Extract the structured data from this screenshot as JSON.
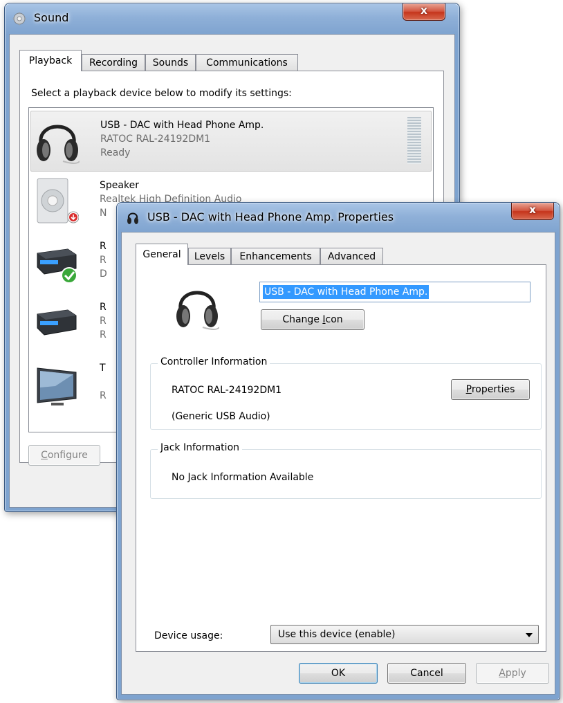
{
  "sound_window": {
    "title": "Sound",
    "close_label": "x",
    "tabs": [
      {
        "label": "Playback"
      },
      {
        "label": "Recording"
      },
      {
        "label": "Sounds"
      },
      {
        "label": "Communications"
      }
    ],
    "instruction": "Select a playback device below to modify its settings:",
    "devices": [
      {
        "name": "USB - DAC with Head Phone Amp.",
        "driver": "RATOC RAL-24192DM1",
        "status": "Ready",
        "icon": "headphones-icon",
        "selected": true
      },
      {
        "name": "Speaker",
        "driver": "Realtek High Definition Audio",
        "status": "N",
        "icon": "speaker-icon",
        "badge": "disabled-badge"
      },
      {
        "name": "R",
        "driver": "R",
        "status": "D",
        "icon": "receiver-icon",
        "badge": "default-check-badge"
      },
      {
        "name": "R",
        "driver": "R",
        "status": "R",
        "icon": "receiver-icon"
      },
      {
        "name": "T",
        "driver": "",
        "status": "R",
        "icon": "monitor-icon"
      }
    ],
    "configure_button": {
      "pre": "",
      "underline": "C",
      "post": "onfigure"
    }
  },
  "properties_dialog": {
    "title": "USB - DAC with Head Phone Amp. Properties",
    "close_label": "x",
    "tabs": [
      {
        "label": "General"
      },
      {
        "label": "Levels"
      },
      {
        "label": "Enhancements"
      },
      {
        "label": "Advanced"
      }
    ],
    "device_name_value": "USB - DAC with Head Phone Amp.",
    "change_icon_button": {
      "pre": "Change ",
      "underline": "I",
      "post": "con"
    },
    "controller_group": {
      "label": "Controller Information",
      "controller_name": "RATOC RAL-24192DM1",
      "controller_type": "(Generic USB Audio)",
      "properties_button": {
        "pre": "",
        "underline": "P",
        "post": "roperties"
      }
    },
    "jack_group": {
      "label": "Jack Information",
      "text": "No Jack Information Available"
    },
    "device_usage": {
      "label": "Device usage:",
      "selected": "Use this device (enable)"
    },
    "buttons": {
      "ok": "OK",
      "cancel": "Cancel",
      "apply": {
        "pre": "",
        "underline": "A",
        "post": "pply"
      }
    }
  }
}
